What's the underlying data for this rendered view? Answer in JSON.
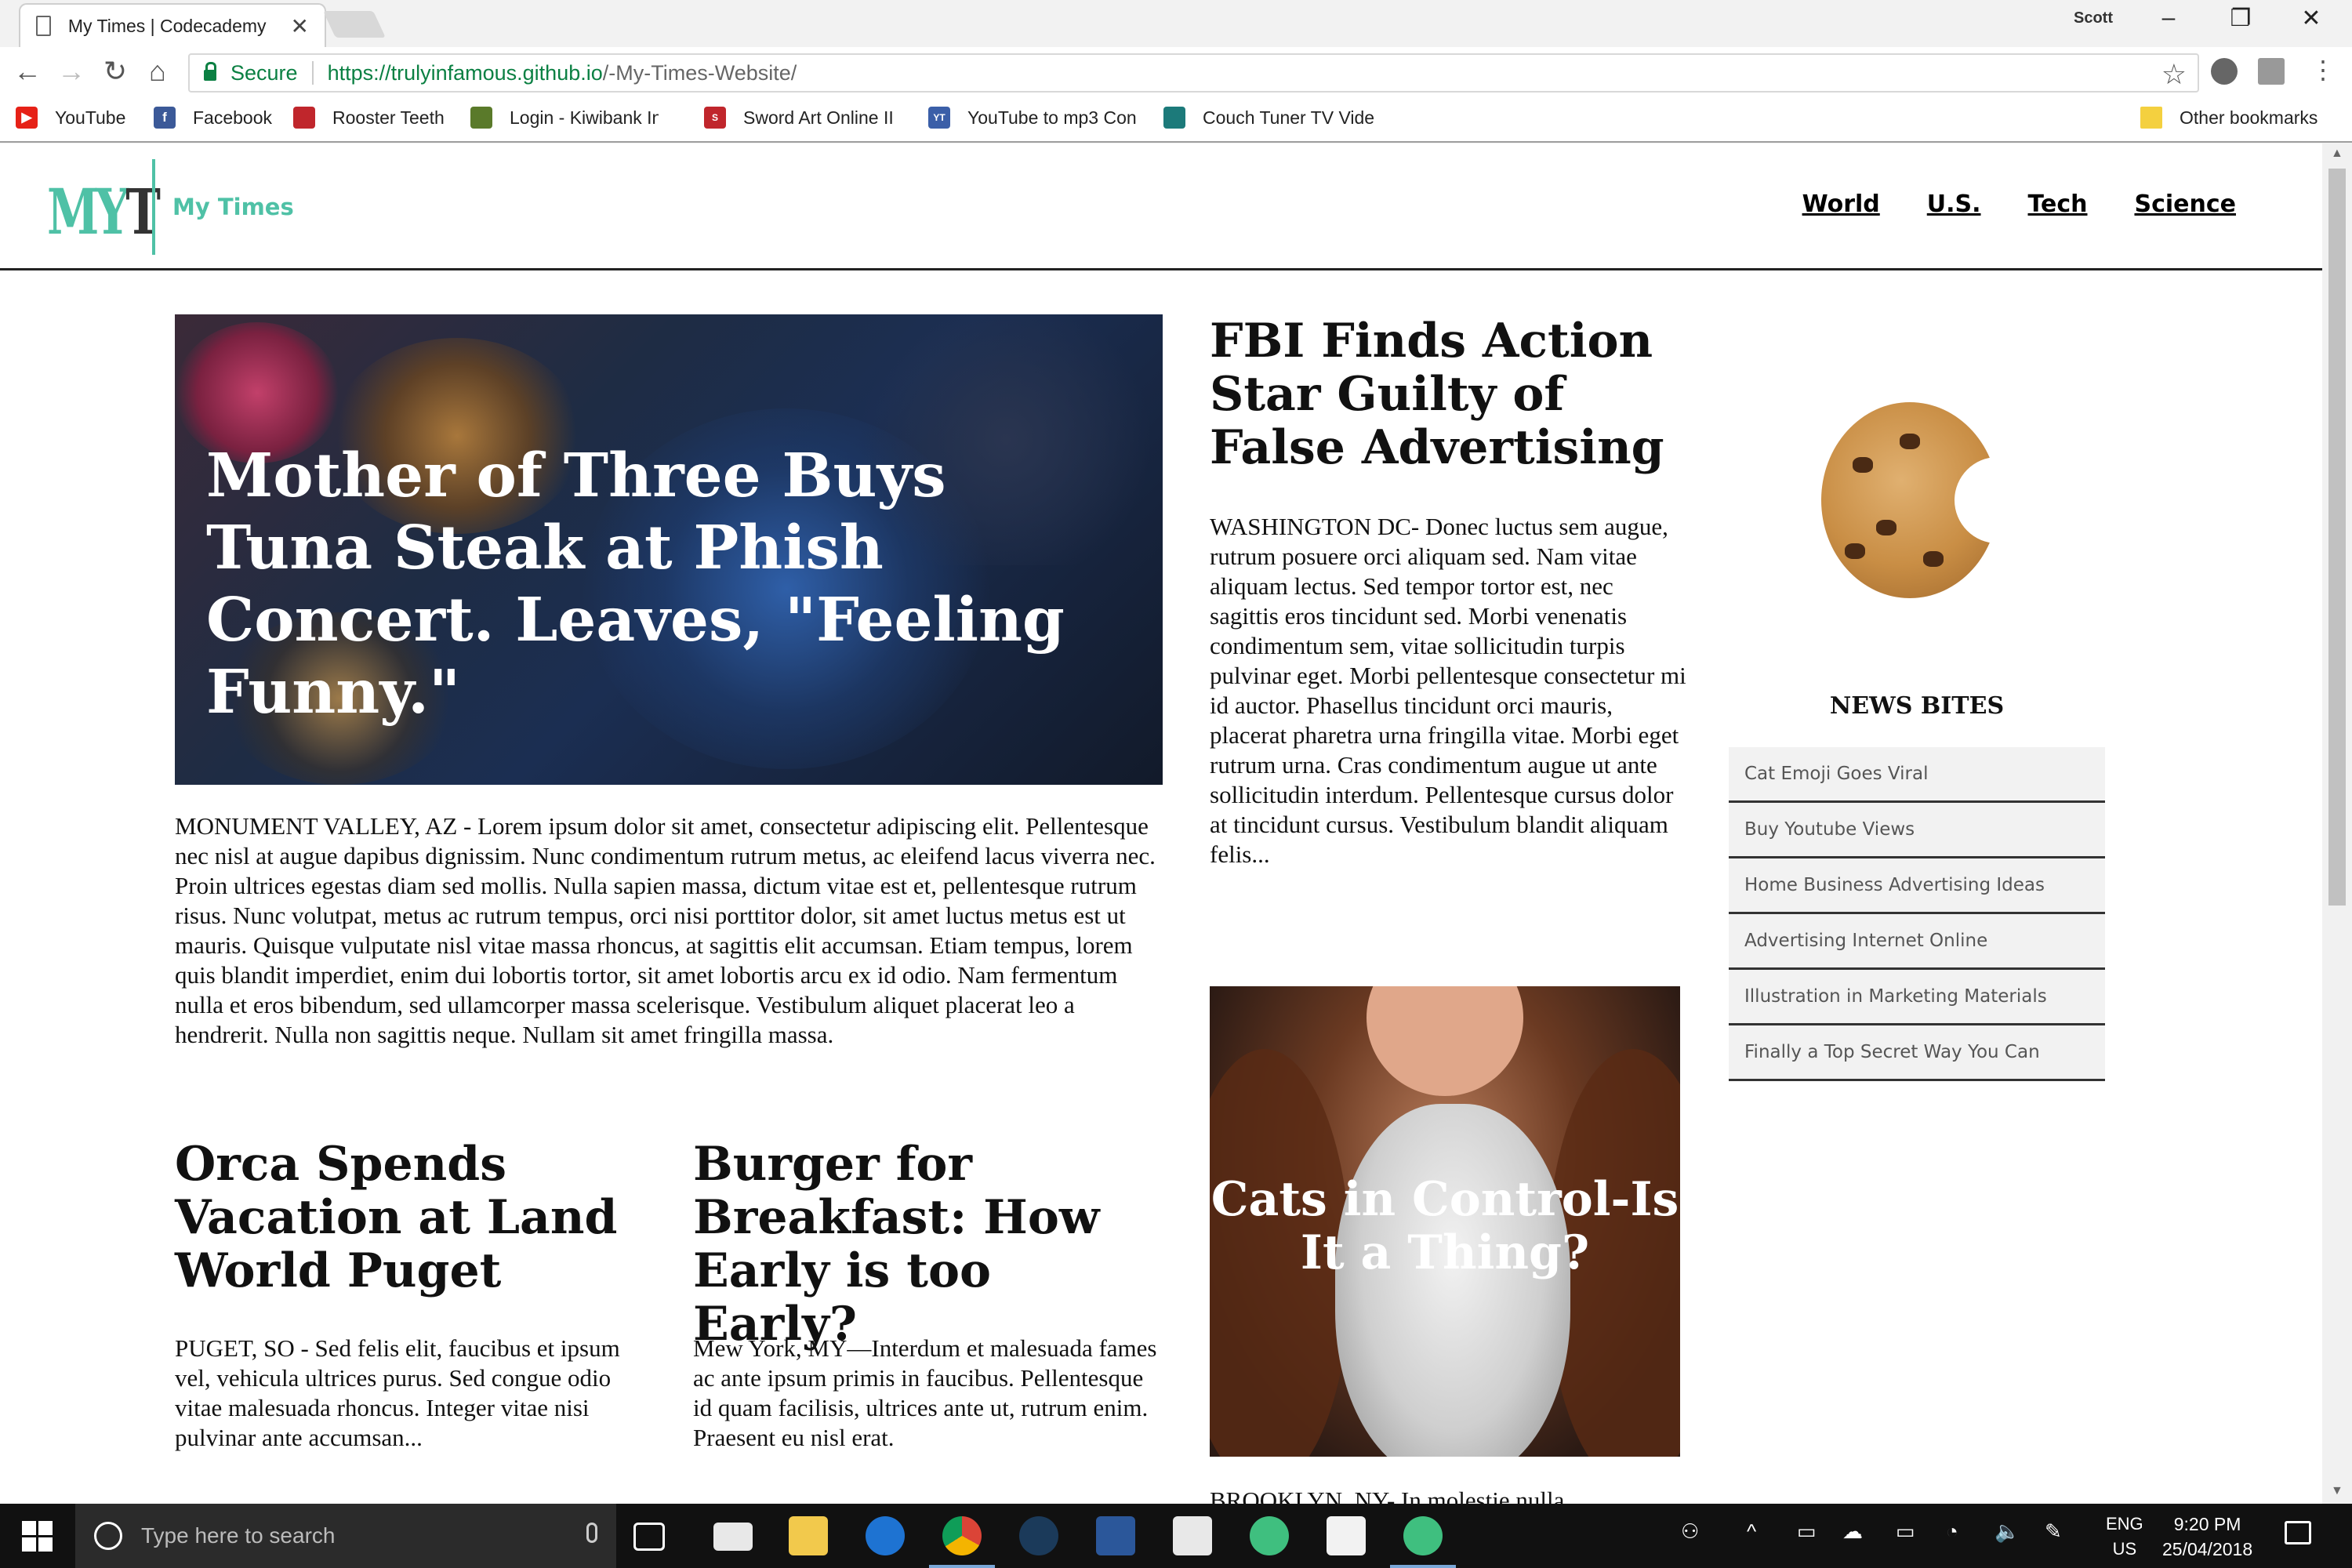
{
  "browser": {
    "tab_title": "My Times | Codecademy",
    "tab_close": "✕",
    "user_name": "Scott",
    "secure_label": "Secure",
    "url_host": "https://trulyinfamous.github.io",
    "url_path": "/-My-Times-Website/",
    "bookmarks": [
      {
        "label": "YouTube",
        "icon": "youtube-icon",
        "color": "#e62117"
      },
      {
        "label": "Facebook",
        "icon": "facebook-icon",
        "color": "#3b5998"
      },
      {
        "label": "Rooster Teeth",
        "icon": "rooster-teeth-icon",
        "color": "#c0262c"
      },
      {
        "label": "Login - Kiwibank Inte",
        "icon": "kiwibank-icon",
        "color": "#5a7a2a"
      },
      {
        "label": "Sword Art Online II",
        "icon": "sao-icon",
        "color": "#c0262c"
      },
      {
        "label": "YouTube to mp3 Con",
        "icon": "ytmp3-icon",
        "color": "#3b5fa8"
      },
      {
        "label": "Couch Tuner TV Vide",
        "icon": "couchtuner-icon",
        "color": "#1c7a7a"
      }
    ],
    "other_bookmarks": "Other bookmarks"
  },
  "site": {
    "logo_my": "MY",
    "logo_t": "T",
    "brand_name": "My Times",
    "nav": [
      "World",
      "U.S.",
      "Tech",
      "Science"
    ],
    "accent_color": "#4fc1a6"
  },
  "hero": {
    "title": "Mother of Three Buys Tuna Steak at Phish Concert. Leaves, \"Feeling Funny.\"",
    "body": "MONUMENT VALLEY, AZ - Lorem ipsum dolor sit amet, consectetur adipiscing elit. Pellentesque nec nisl at augue dapibus dignissim. Nunc condimentum rutrum metus, ac eleifend lacus viverra nec. Proin ultrices egestas diam sed mollis. Nulla sapien massa, dictum vitae est et, pellentesque rutrum risus. Nunc volutpat, metus ac rutrum tempus, orci nisi porttitor dolor, sit amet luctus metus est ut mauris. Quisque vulputate nisl vitae massa rhoncus, at sagittis elit accumsan. Etiam tempus, lorem quis blandit imperdiet, enim dui lobortis tortor, sit amet lobortis arcu ex id odio. Nam fermentum nulla et eros bibendum, sed ullamcorper massa scelerisque. Vestibulum aliquet placerat leo a hendrerit. Nulla non sagittis neque. Nullam sit amet fringilla massa."
  },
  "stories": {
    "orca": {
      "title": "Orca Spends Vacation at Land World Puget",
      "body": "PUGET, SO - Sed felis elit, faucibus et ipsum vel, vehicula ultrices purus. Sed congue odio vitae malesuada rhoncus. Integer vitae nisi pulvinar ante accumsan..."
    },
    "burger": {
      "title": "Burger for Breakfast: How Early is too Early?",
      "body": "Mew York, MY—Interdum et malesuada fames ac ante ipsum primis in faucibus. Pellentesque id quam facilisis, ultrices ante ut, rutrum enim. Praesent eu nisl erat."
    },
    "fbi": {
      "title": "FBI Finds Action Star Guilty of False Advertising",
      "body": "WASHINGTON DC- Donec luctus sem augue, rutrum posuere orci aliquam sed. Nam vitae aliquam lectus. Sed tempor tortor est, nec sagittis eros tincidunt sed. Morbi venenatis condimentum sem, vitae sollicitudin turpis pulvinar eget. Morbi pellentesque consectetur mi id auctor. Phasellus tincidunt orci mauris, placerat pharetra urna fringilla vitae. Morbi eget rutrum urna. Cras condimentum augue ut ante sollicitudin interdum. Pellentesque cursus dolor at tincidunt cursus. Vestibulum blandit aliquam felis..."
    },
    "cats": {
      "caption": "Cats in Control-Is It a Thing?",
      "body": "BROOKLYN, NY- In molestie nulla"
    }
  },
  "news_bites": {
    "title": "NEWS BITES",
    "items": [
      "Cat Emoji Goes Viral",
      "Buy Youtube Views",
      "Home Business Advertising Ideas",
      "Advertising Internet Online",
      "Illustration in Marketing Materials",
      "Finally a Top Secret Way You Can"
    ]
  },
  "taskbar": {
    "search_placeholder": "Type here to search",
    "lang_line1": "ENG",
    "lang_line2": "US",
    "time": "9:20 PM",
    "date": "25/04/2018"
  }
}
